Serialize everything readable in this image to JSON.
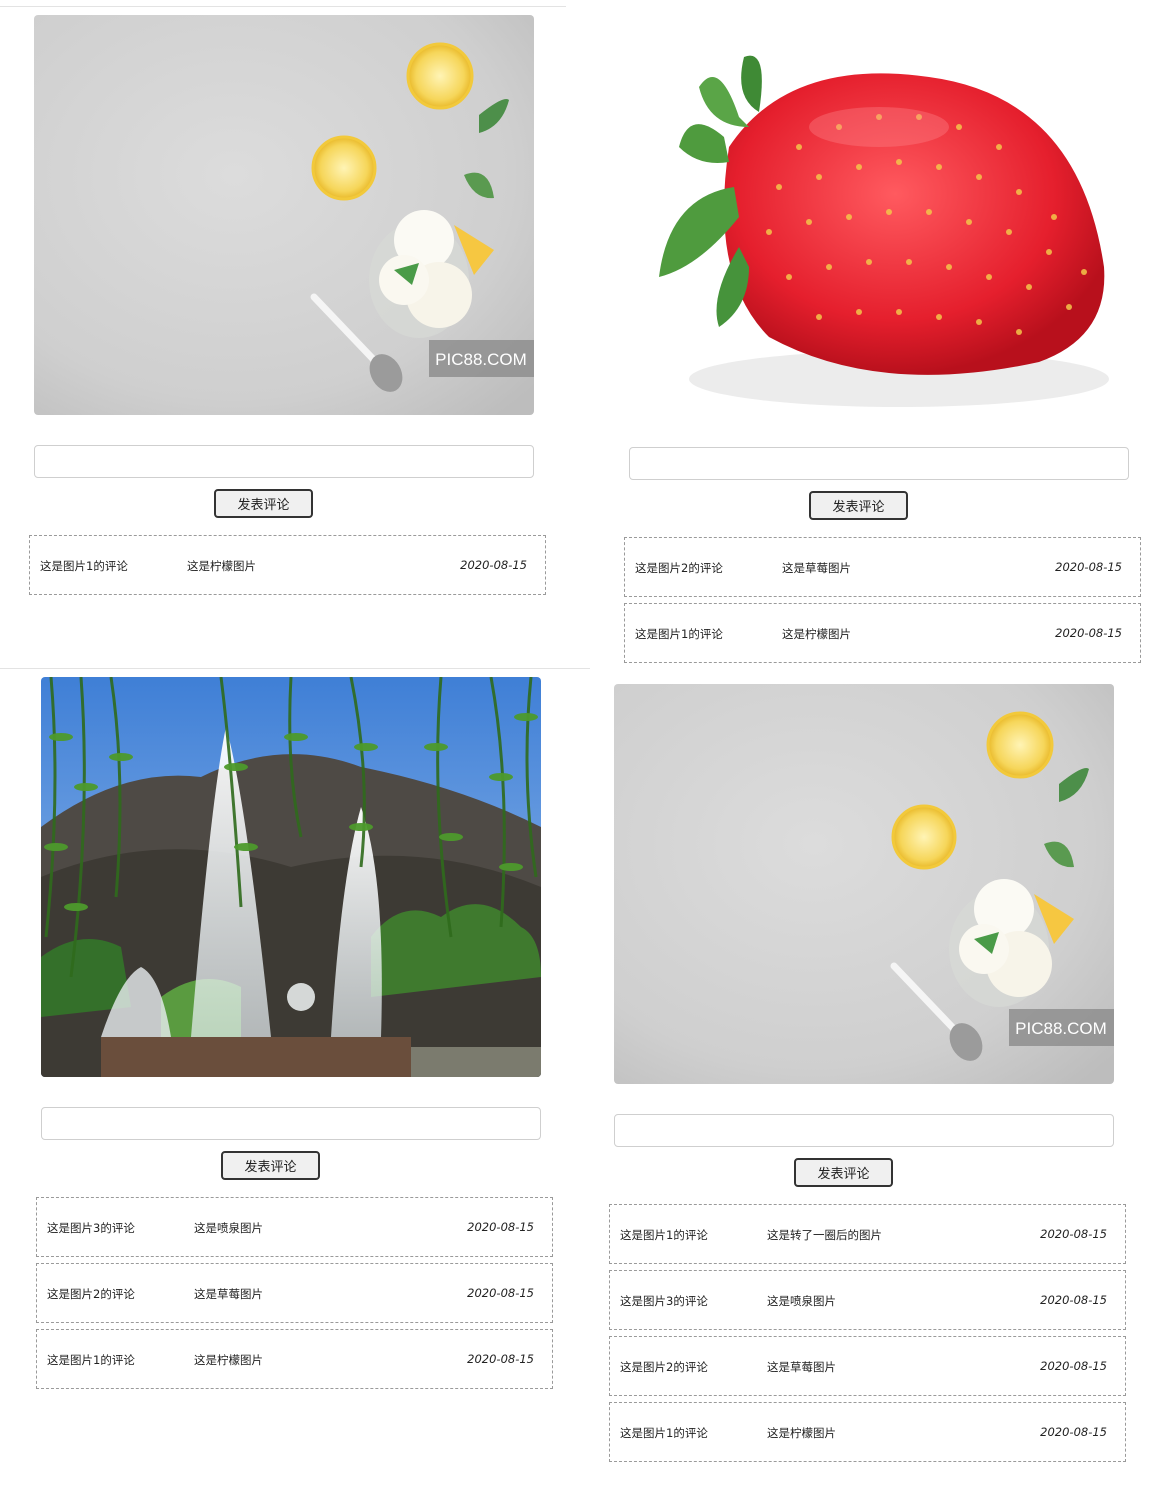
{
  "post_label": "发表评论",
  "watermark": "PIC88.COM",
  "cards": [
    {
      "image": "lemon-icecream-photo",
      "comments": [
        {
          "text": "这是图片1的评论",
          "title": "这是柠檬图片",
          "date": "2020-08-15"
        }
      ]
    },
    {
      "image": "strawberry-photo",
      "comments": [
        {
          "text": "这是图片2的评论",
          "title": "这是草莓图片",
          "date": "2020-08-15"
        },
        {
          "text": "这是图片1的评论",
          "title": "这是柠檬图片",
          "date": "2020-08-15"
        }
      ]
    },
    {
      "image": "fountain-photo",
      "comments": [
        {
          "text": "这是图片3的评论",
          "title": "这是喷泉图片",
          "date": "2020-08-15"
        },
        {
          "text": "这是图片2的评论",
          "title": "这是草莓图片",
          "date": "2020-08-15"
        },
        {
          "text": "这是图片1的评论",
          "title": "这是柠檬图片",
          "date": "2020-08-15"
        }
      ]
    },
    {
      "image": "lemon-icecream-photo",
      "comments": [
        {
          "text": "这是图片1的评论",
          "title": "这是转了一圈后的图片",
          "date": "2020-08-15"
        },
        {
          "text": "这是图片3的评论",
          "title": "这是喷泉图片",
          "date": "2020-08-15"
        },
        {
          "text": "这是图片2的评论",
          "title": "这是草莓图片",
          "date": "2020-08-15"
        },
        {
          "text": "这是图片1的评论",
          "title": "这是柠檬图片",
          "date": "2020-08-15"
        }
      ]
    }
  ]
}
